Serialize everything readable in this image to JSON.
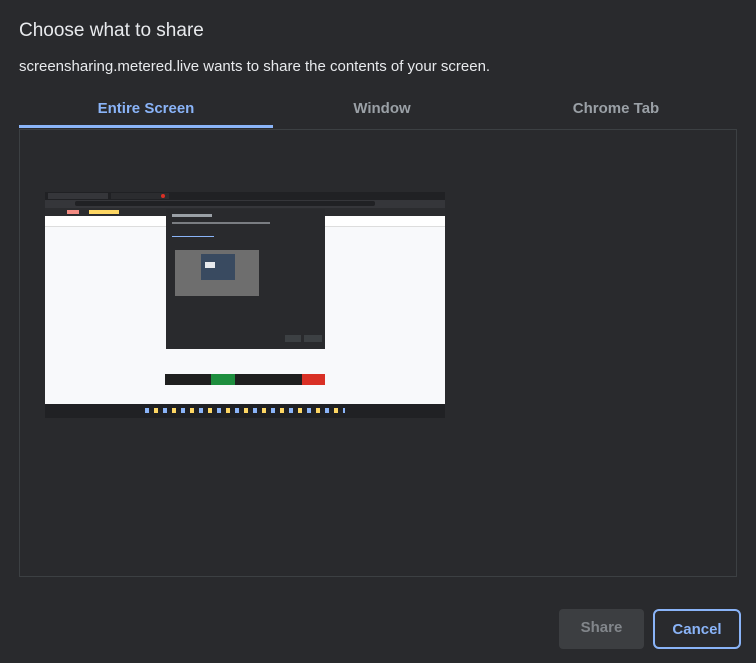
{
  "dialog": {
    "title": "Choose what to share",
    "subtitle": "screensharing.metered.live wants to share the contents of your screen."
  },
  "tabs": [
    {
      "label": "Entire Screen",
      "active": true
    },
    {
      "label": "Window",
      "active": false
    },
    {
      "label": "Chrome Tab",
      "active": false
    }
  ],
  "preview": {
    "thumbnail": "entire-screen-thumbnail"
  },
  "buttons": {
    "share_label": "Share",
    "share_enabled": false,
    "cancel_label": "Cancel"
  },
  "colors": {
    "background": "#292a2d",
    "accent": "#8ab4f8",
    "text": "#e8eaed",
    "muted": "#9aa0a6"
  }
}
